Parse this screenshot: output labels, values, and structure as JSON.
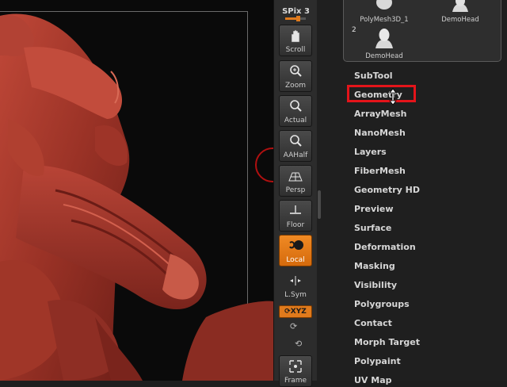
{
  "shelf": {
    "spix_label": "SPix 3",
    "spix_level": 0.6,
    "buttons": [
      {
        "label": "Scroll",
        "icon": "hand-icon"
      },
      {
        "label": "Zoom",
        "icon": "magnifier-plus-icon"
      },
      {
        "label": "Actual",
        "icon": "magnifier-1x-icon"
      },
      {
        "label": "AAHalf",
        "icon": "magnifier-half-icon"
      },
      {
        "label": "Persp",
        "icon": "perspective-grid-icon"
      },
      {
        "label": "Floor",
        "icon": "floor-icon"
      },
      {
        "label": "Local",
        "icon": "local-icon",
        "active": true
      },
      {
        "label": "L.Sym",
        "icon": "local-symmetry-icon"
      }
    ],
    "xyz_label": "XYZ",
    "frame_label": "Frame"
  },
  "subtools": {
    "items": [
      {
        "name": "PolyMesh3D_1"
      },
      {
        "name": "DemoHead"
      },
      {
        "name": "DemoHead",
        "index": "2"
      }
    ]
  },
  "menu": {
    "items": [
      "SubTool",
      "Geometry",
      "ArrayMesh",
      "NanoMesh",
      "Layers",
      "FiberMesh",
      "Geometry HD",
      "Preview",
      "Surface",
      "Deformation",
      "Masking",
      "Visibility",
      "Polygroups",
      "Contact",
      "Morph Target",
      "Polypaint",
      "UV Map"
    ],
    "highlighted": "Geometry"
  },
  "colors": {
    "accent": "#e07a1c",
    "highlight": "#e4141a",
    "model": "#a8392e"
  }
}
